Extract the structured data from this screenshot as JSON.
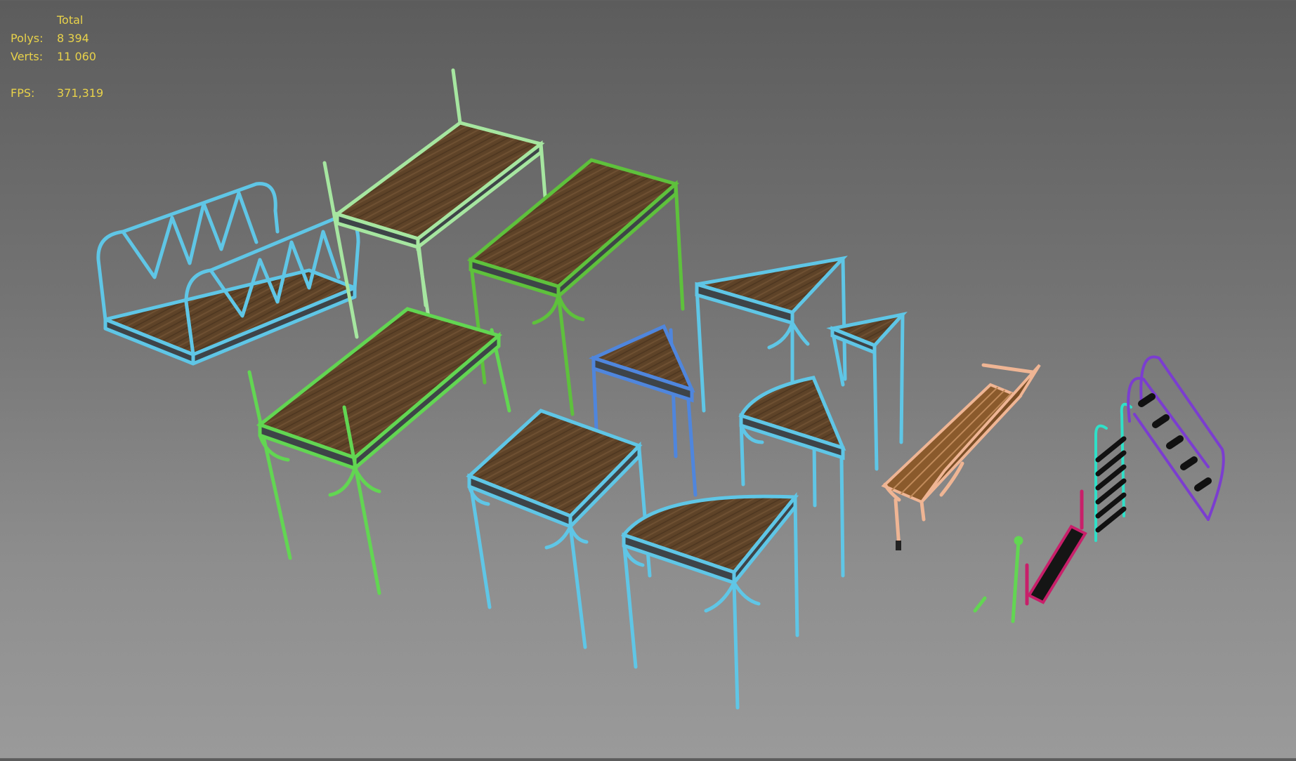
{
  "viewport": {
    "background_top": "#5c5c5c",
    "background_bottom": "#9a9a9a",
    "stats_color": "#e8d24a"
  },
  "stats": {
    "header": "Total",
    "polys_label": "Polys:",
    "polys_value": "8 394",
    "verts_label": "Verts:",
    "verts_value": "11 060",
    "fps_label": "FPS:",
    "fps_value": "371,319"
  },
  "colors": {
    "wood": "#5e4328",
    "wood_dark": "#4a3320",
    "frame_dark": "#3e4448",
    "cyan": "#5fc6e6",
    "light_green": "#a6e6a0",
    "green": "#5ec13c",
    "bright_green": "#62d652",
    "blue": "#4f86dd",
    "peach": "#efb594",
    "bench_wood": "#8a5a2c",
    "magenta": "#c81f6a",
    "purple": "#7b3dd0",
    "teal": "#2fe0c8"
  }
}
